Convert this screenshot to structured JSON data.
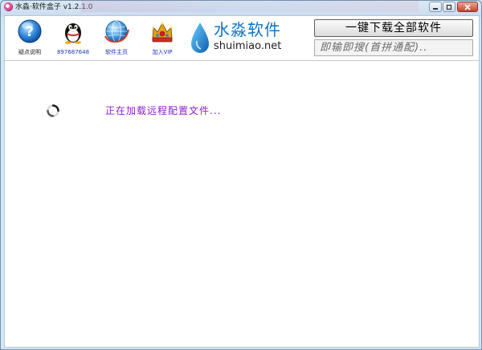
{
  "window": {
    "title": "水淼·软件盒子 v1.2.1.0"
  },
  "toolbar": {
    "items": [
      {
        "label": "疑点说明",
        "icon": "help-icon"
      },
      {
        "label": "897687648",
        "icon": "qq-penguin-icon"
      },
      {
        "label": "软件主页",
        "icon": "globe-icon"
      },
      {
        "label": "加入VIP",
        "icon": "crown-icon"
      }
    ]
  },
  "logo": {
    "name": "水淼软件",
    "domain": "shuimiao.net",
    "icon": "water-drop-logo-icon"
  },
  "actions": {
    "download_all_label": "一键下载全部软件"
  },
  "search": {
    "value": "即输即搜(首拼通配)..",
    "placeholder": "即输即搜(首拼通配).."
  },
  "status": {
    "loading_text": "正在加载远程配置文件...",
    "icon": "loading-spinner-icon"
  },
  "colors": {
    "accent_blue": "#0f73c4",
    "loading_purple": "#8a1fd6",
    "label_blue": "#1a35b8"
  }
}
